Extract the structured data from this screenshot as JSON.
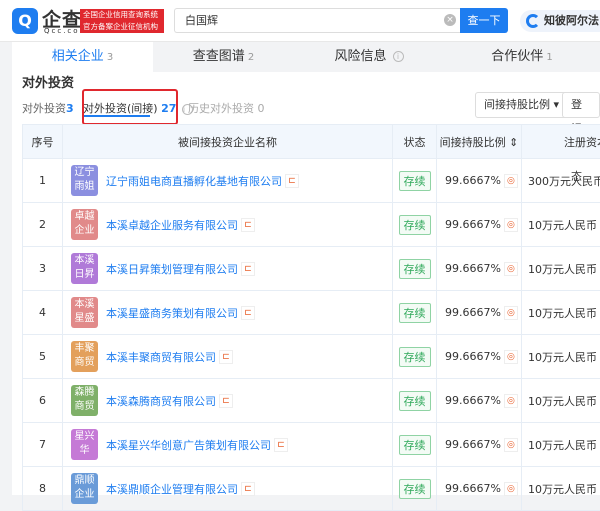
{
  "header": {
    "logo_glyph": "Q",
    "brand": "企查查",
    "brand_sub": "Qcc.com",
    "slogan_line1": "全国企业信用查询系统",
    "slogan_line2": "官方备案企业征信机构",
    "search_value": "白国辉",
    "search_button": "查一下",
    "ad_text": "知彼阿尔法"
  },
  "tabs": [
    {
      "label": "相关企业",
      "count": "3"
    },
    {
      "label": "查查图谱",
      "count": "2"
    },
    {
      "label": "风险信息",
      "count": ""
    },
    {
      "label": "合作伙伴",
      "count": "1"
    }
  ],
  "section": {
    "title": "对外投资",
    "subtabs": [
      {
        "label": "对外投资",
        "count": "3"
      },
      {
        "label": "对外投资(间接)",
        "count": "27"
      },
      {
        "label": "历史对外投资",
        "count": "0"
      }
    ],
    "filter_button": "间接持股比例 ▾",
    "register_button": "登记状态"
  },
  "table": {
    "headers": [
      "序号",
      "被间接投资企业名称",
      "状态",
      "间接持股比例 ⇕",
      "注册资本"
    ],
    "rows": [
      {
        "no": "1",
        "logo": [
          "辽宁",
          "雨姐"
        ],
        "color": "#8b8fe0",
        "name": "辽宁雨姐电商直播孵化基地有限公司",
        "status": "存续",
        "ratio": "99.6667%",
        "capital": "300万元人民币"
      },
      {
        "no": "2",
        "logo": [
          "卓越",
          "企业"
        ],
        "color": "#e18a8a",
        "name": "本溪卓越企业服务有限公司",
        "status": "存续",
        "ratio": "99.6667%",
        "capital": "10万元人民币"
      },
      {
        "no": "3",
        "logo": [
          "本溪",
          "日昇"
        ],
        "color": "#b07ad8",
        "name": "本溪日昇策划管理有限公司",
        "status": "存续",
        "ratio": "99.6667%",
        "capital": "10万元人民币"
      },
      {
        "no": "4",
        "logo": [
          "本溪",
          "星盛"
        ],
        "color": "#e18a8a",
        "name": "本溪星盛商务策划有限公司",
        "status": "存续",
        "ratio": "99.6667%",
        "capital": "10万元人民币"
      },
      {
        "no": "5",
        "logo": [
          "丰聚",
          "商贸"
        ],
        "color": "#e3a05c",
        "name": "本溪丰聚商贸有限公司",
        "status": "存续",
        "ratio": "99.6667%",
        "capital": "10万元人民币"
      },
      {
        "no": "6",
        "logo": [
          "森腾",
          "商贸"
        ],
        "color": "#7fb069",
        "name": "本溪森腾商贸有限公司",
        "status": "存续",
        "ratio": "99.6667%",
        "capital": "10万元人民币"
      },
      {
        "no": "7",
        "logo": [
          "星兴",
          "华"
        ],
        "color": "#c57ad6",
        "name": "本溪星兴华创意广告策划有限公司",
        "status": "存续",
        "ratio": "99.6667%",
        "capital": "10万元人民币"
      },
      {
        "no": "8",
        "logo": [
          "鼎顺",
          "企业"
        ],
        "color": "#6a9bd8",
        "name": "本溪鼎顺企业管理有限公司",
        "status": "存续",
        "ratio": "99.6667%",
        "capital": "10万元人民币"
      }
    ]
  }
}
